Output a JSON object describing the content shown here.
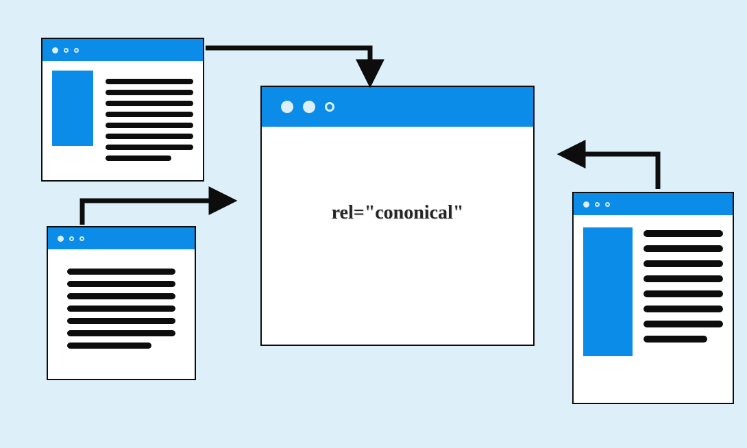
{
  "diagram": {
    "center_label": "rel=\"cononical\"",
    "concept": "canonical-url",
    "windows": {
      "top_left": {
        "role": "duplicate-page"
      },
      "bottom_left": {
        "role": "duplicate-page"
      },
      "right": {
        "role": "duplicate-page"
      },
      "center": {
        "role": "canonical-target"
      }
    },
    "colors": {
      "background": "#ddeff8",
      "accent": "#0c8ce9",
      "stroke": "#0d0d0d"
    }
  }
}
